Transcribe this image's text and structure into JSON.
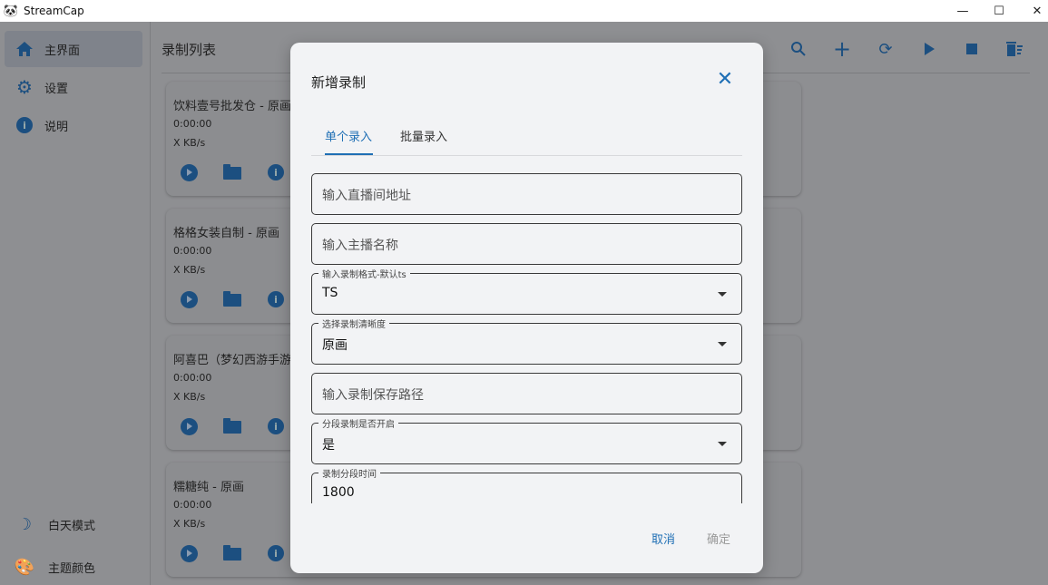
{
  "app": {
    "title": "StreamCap"
  },
  "window": {
    "minimize": "—",
    "maximize": "☐",
    "close": "✕"
  },
  "sidebar": {
    "items": [
      {
        "label": "主界面",
        "icon": "home-icon"
      },
      {
        "label": "设置",
        "icon": "gear-icon"
      },
      {
        "label": "说明",
        "icon": "info-icon"
      }
    ],
    "bottom": [
      {
        "label": "白天模式",
        "icon": "moon-icon"
      },
      {
        "label": "主题颜色",
        "icon": "palette-icon"
      }
    ]
  },
  "main": {
    "title": "录制列表",
    "toolbar": [
      "search",
      "add",
      "refresh",
      "play",
      "stop",
      "delete"
    ],
    "cards": [
      {
        "title": "饮料壹号批发仓 - 原画",
        "duration": "0:00:00",
        "speed": "X KB/s"
      },
      {
        "title": "格格女装自制 - 原画",
        "duration": "0:00:00",
        "speed": "X KB/s"
      },
      {
        "title": "阿喜巴（梦幻西游手游",
        "duration": "0:00:00",
        "speed": "X KB/s"
      },
      {
        "title": "糯糖纯 - 原画",
        "duration": "0:00:00",
        "speed": "X KB/s"
      }
    ]
  },
  "dialog": {
    "title": "新增录制",
    "tabs": [
      "单个录入",
      "批量录入"
    ],
    "fields": [
      {
        "placeholder": "输入直播间地址"
      },
      {
        "placeholder": "输入主播名称"
      },
      {
        "label": "输入录制格式-默认ts",
        "value": "TS"
      },
      {
        "label": "选择录制清晰度",
        "value": "原画"
      },
      {
        "placeholder": "输入录制保存路径"
      },
      {
        "label": "分段录制是否开启",
        "value": "是"
      },
      {
        "label": "录制分段时间",
        "value": "1800"
      }
    ],
    "cancel": "取消",
    "confirm": "确定"
  },
  "colors": {
    "accent": "#1f6fb5",
    "overlay": "#8e8f92"
  }
}
